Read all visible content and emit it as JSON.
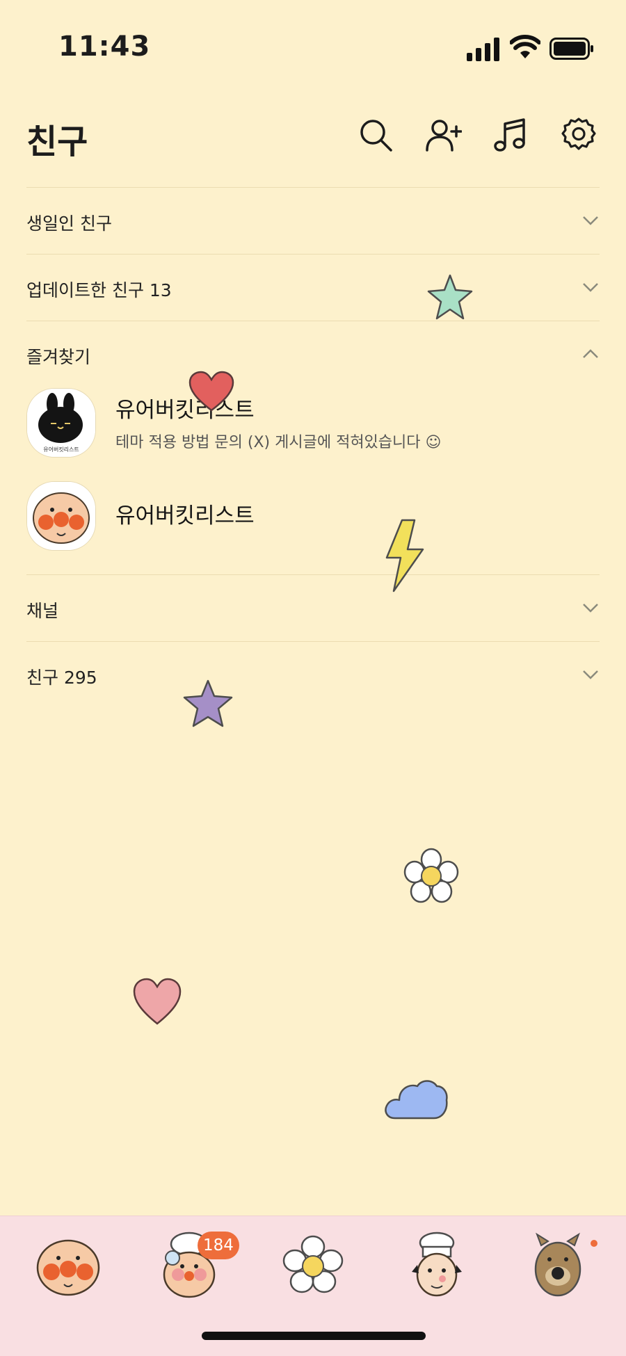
{
  "status_bar": {
    "time": "11:43"
  },
  "header": {
    "title": "친구",
    "icons": [
      "search-icon",
      "add-friend-icon",
      "music-icon",
      "settings-icon"
    ]
  },
  "sections": {
    "birthday": {
      "label": "생일인 친구"
    },
    "updated": {
      "label": "업데이트한 친구 13"
    },
    "favorites": {
      "label": "즐겨찾기",
      "items": [
        {
          "name": "유어버킷리스트",
          "status": "테마 적용 방법 문의 (X) 게시글에 적혀있습니다 ☺"
        },
        {
          "name": "유어버킷리스트"
        }
      ]
    },
    "channel": {
      "label": "채널"
    },
    "friends": {
      "label": "친구 295"
    }
  },
  "avatar_caption": "유어버킷리스트",
  "tabbar": {
    "tabs": [
      "friends-tab",
      "chats-tab",
      "view-tab",
      "shopping-tab",
      "more-tab"
    ],
    "chats_badge": "184"
  },
  "colors": {
    "background": "#fdf1cc",
    "tabbar": "#f9dfe2",
    "badge": "#ee6d3b"
  }
}
